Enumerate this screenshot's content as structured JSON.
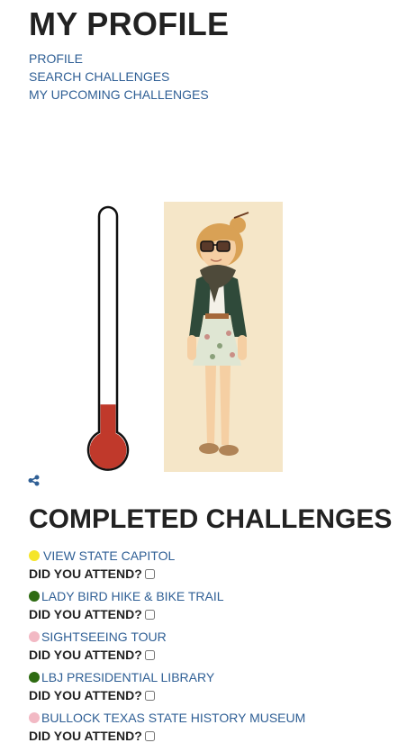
{
  "page": {
    "title": "MY PROFILE"
  },
  "nav": {
    "items": [
      "PROFILE",
      "SEARCH CHALLENGES",
      "MY UPCOMING CHALLENGES"
    ]
  },
  "progress": {
    "level": 0.15,
    "fill_color": "#c0392b"
  },
  "colors": {
    "link": "#2f5f95",
    "avatar_bg": "#f5e6c8"
  },
  "share": {
    "icon": "share-icon"
  },
  "completed": {
    "title": "COMPLETED CHALLENGES",
    "attend_label": "DID YOU ATTEND?",
    "items": [
      {
        "label": "VIEW STATE CAPITOL",
        "color": "#f5e52a",
        "spaced": true
      },
      {
        "label": "LADY BIRD HIKE & BIKE TRAIL",
        "color": "#2e6b12",
        "spaced": false
      },
      {
        "label": "SIGHTSEEING TOUR",
        "color": "#f2b9c4",
        "spaced": false
      },
      {
        "label": "LBJ PRESIDENTIAL LIBRARY",
        "color": "#2e6b12",
        "spaced": false
      },
      {
        "label": "BULLOCK TEXAS STATE HISTORY MUSEUM",
        "color": "#f2b9c4",
        "spaced": false
      }
    ]
  }
}
